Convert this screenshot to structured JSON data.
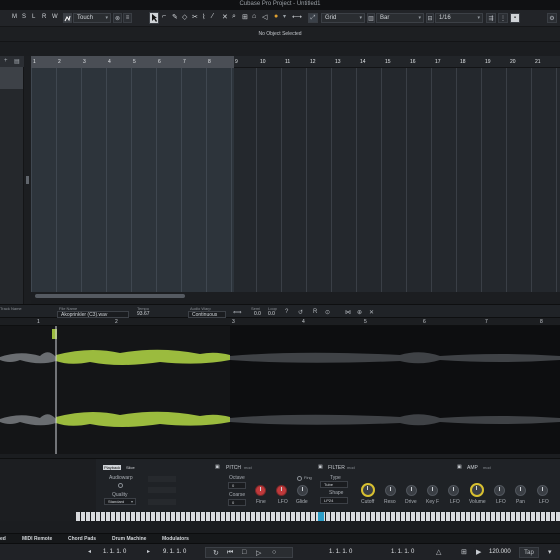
{
  "window": {
    "title": "Cubase Pro Project - Untitled1"
  },
  "toolbar": {
    "mode_buttons": [
      "M",
      "S",
      "L",
      "R",
      "W",
      "A"
    ],
    "automation_mode": "Touch",
    "snap_type": "Grid",
    "grid_type": "Bar",
    "quantize": "1/16"
  },
  "info_line": {
    "text": "No Object Selected"
  },
  "project": {
    "ruler_numbers": [
      "1",
      "2",
      "3",
      "4",
      "5",
      "6",
      "7",
      "8",
      "9",
      "10",
      "11",
      "12",
      "13",
      "14",
      "15",
      "16",
      "17",
      "18",
      "19",
      "20",
      "21"
    ]
  },
  "sample_editor": {
    "header_label": "Track Name",
    "file_name_label": "File Name",
    "file_name": "Akoprinkler (C3).wav",
    "tempo_label": "Tempo",
    "tempo": "93.67",
    "audio_warp_label": "Audio Warp",
    "audio_warp": "Continuous",
    "semi_label": "Semi",
    "semi": "0.0",
    "loop_label": "Loop",
    "loop": "0.0",
    "ruler_numbers": [
      "1",
      "2",
      "3",
      "4",
      "5",
      "6",
      "7",
      "8"
    ]
  },
  "sampler": {
    "playback_label": "Playback",
    "playback_mode": "Slice",
    "audiowarp_label": "Audiowarp",
    "quality_label": "Quality",
    "quality": "Standard",
    "pitch_label": "PITCH",
    "pitch_mod": "mod",
    "octave_label": "Octave",
    "octave": "0",
    "coarse_label": "Coarse",
    "coarse": "0",
    "fine_label": "Fine",
    "lfo_label": "LFO",
    "glide_label": "Glide",
    "fing_label": "Fing",
    "filter_label": "FILTER",
    "filter_mod": "mod",
    "type_label": "Type",
    "filter_type": "Tube",
    "shape_label": "Shape",
    "filter_shape": "LP24",
    "cutoff_label": "Cutoff",
    "reso_label": "Reso",
    "drive_label": "Drive",
    "keyf_label": "Key F",
    "filter_lfo_label": "LFO",
    "amp_label": "AMP",
    "amp_mod": "mod",
    "volume_label": "Volume",
    "amp_lfo_label": "LFO",
    "pan_label": "Pan",
    "amp_lfo2_label": "LFO"
  },
  "bottom_tabs": [
    "ed",
    "MIDI Remote",
    "Chord Pads",
    "Drum Machine",
    "Modulators"
  ],
  "transport": {
    "left_locator": "1. 1. 1. 0",
    "right_locator": "9. 1. 1. 0",
    "position": "1. 1. 1. 0",
    "position2": "1. 1. 1. 0",
    "tempo": "120.000",
    "tap_label": "Tap"
  },
  "colors": {
    "accent": "#2b9ec9",
    "waveform_selected": "#9bbb3e",
    "waveform_dim": "#5a5d61"
  }
}
